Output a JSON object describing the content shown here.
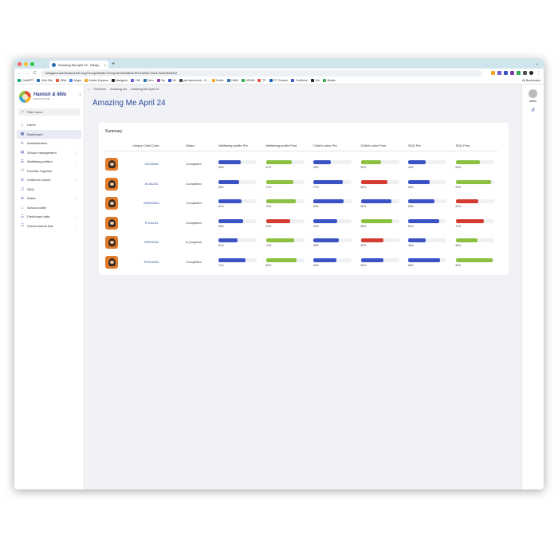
{
  "browser": {
    "tab_title": "Amazing Me April 24 - Navig...",
    "tab_close": "×",
    "new_tab": "+",
    "url": "navigator.hamishandmilo.org/GroupDetails?GroupId=09c0f62b-8f13-6850-34c3-3a1038334af",
    "back": "←",
    "forward": "→",
    "reload": "C",
    "bookmarks": [
      "ChatGPT",
      "Visit Site",
      "OBie",
      "Maps",
      "Adobe Express",
      "Navigator",
      "HM",
      "Xero",
      "Sq",
      "YA",
      "ppt framework - G...",
      "Buffer",
      "HMM",
      "AR365",
      "TP",
      "RT Cleaner",
      "OneDrive",
      "Goi",
      "Bmato"
    ],
    "all_bookmarks": "All Bookmarks"
  },
  "sidebar": {
    "logo_title": "Hamish & Milo",
    "logo_sub": "NAVIGATOR",
    "filter_label": "Filter menu",
    "items": [
      {
        "label": "Home",
        "icon": "⌂",
        "caret": ""
      },
      {
        "label": "Dashboard",
        "icon": "▦",
        "caret": ""
      },
      {
        "label": "Administration",
        "icon": "✎",
        "caret": "⌄"
      },
      {
        "label": "School management",
        "icon": "▤",
        "caret": "⌄"
      },
      {
        "label": "Wellbeing profiles",
        "icon": "☰",
        "caret": "⌄"
      },
      {
        "label": "Families Together",
        "icon": "⚇",
        "caret": ""
      },
      {
        "label": "Childrens voices",
        "icon": "✆",
        "caret": "⌄"
      },
      {
        "label": "SDQ",
        "icon": "▢",
        "caret": ""
      },
      {
        "label": "Notes",
        "icon": "✉",
        "caret": "⌄"
      },
      {
        "label": "School profile",
        "icon": "⌂",
        "caret": ""
      },
      {
        "label": "Dashboard data",
        "icon": "☷",
        "caret": "⌄"
      },
      {
        "label": "Global shared lists",
        "icon": "☷",
        "caret": "⌄"
      }
    ]
  },
  "breadcrumb": {
    "home": "⌂",
    "items": [
      "Overview",
      "Amazing me",
      "Amazing Me April 24"
    ]
  },
  "page_title": "Amazing Me April 24",
  "summary": {
    "title": "Summary",
    "columns": [
      "Unique Child Code",
      "Status",
      "Wellbeing profile Pre",
      "Wellbeing profile Post",
      "Child's voice Pre",
      "Child's voice Post",
      "SDQ Pre",
      "SDQ Post"
    ],
    "rows": [
      {
        "code": "OC04246",
        "status": "Completed",
        "scores": [
          {
            "label": "58%",
            "value": 0.58,
            "color": "#3a52c4"
          },
          {
            "label": "67%",
            "value": 0.67,
            "color": "#8cc040"
          },
          {
            "label": "46%",
            "value": 0.46,
            "color": "#3a52c4"
          },
          {
            "label": "54%",
            "value": 0.54,
            "color": "#8cc040"
          },
          {
            "label": "46%",
            "value": 0.46,
            "color": "#3a52c4"
          },
          {
            "label": "63%",
            "value": 0.63,
            "color": "#8cc040"
          }
        ]
      },
      {
        "code": "EL04243",
        "status": "Completed",
        "scores": [
          {
            "label": "55%",
            "value": 0.55,
            "color": "#3a52c4"
          },
          {
            "label": "72%",
            "value": 0.72,
            "color": "#8cc040"
          },
          {
            "label": "77%",
            "value": 0.77,
            "color": "#3a52c4"
          },
          {
            "label": "69%",
            "value": 0.69,
            "color": "#d43c32"
          },
          {
            "label": "56%",
            "value": 0.56,
            "color": "#3a52c4"
          },
          {
            "label": "92%",
            "value": 0.92,
            "color": "#8cc040"
          }
        ]
      },
      {
        "code": "EM004243",
        "status": "Completed",
        "scores": [
          {
            "label": "61%",
            "value": 0.61,
            "color": "#3a52c4"
          },
          {
            "label": "79%",
            "value": 0.79,
            "color": "#8cc040"
          },
          {
            "label": "80%",
            "value": 0.8,
            "color": "#3a52c4"
          },
          {
            "label": "80%",
            "value": 0.8,
            "color": "#3a52c4"
          },
          {
            "label": "68%",
            "value": 0.68,
            "color": "#3a52c4"
          },
          {
            "label": "60%",
            "value": 0.6,
            "color": "#d43c32"
          }
        ]
      },
      {
        "code": "FC04244",
        "status": "Completed",
        "scores": [
          {
            "label": "65%",
            "value": 0.65,
            "color": "#3a52c4"
          },
          {
            "label": "64%",
            "value": 0.64,
            "color": "#d43c32"
          },
          {
            "label": "63%",
            "value": 0.63,
            "color": "#3a52c4"
          },
          {
            "label": "83%",
            "value": 0.83,
            "color": "#8cc040"
          },
          {
            "label": "81%",
            "value": 0.81,
            "color": "#3a52c4"
          },
          {
            "label": "74%",
            "value": 0.74,
            "color": "#d43c32"
          }
        ]
      },
      {
        "code": "MH04248",
        "status": "In progress",
        "scores": [
          {
            "label": "51%",
            "value": 0.51,
            "color": "#3a52c4"
          },
          {
            "label": "74%",
            "value": 0.74,
            "color": "#8cc040"
          },
          {
            "label": "66%",
            "value": 0.66,
            "color": "#3a52c4"
          },
          {
            "label": "60%",
            "value": 0.6,
            "color": "#d43c32"
          },
          {
            "label": "46%",
            "value": 0.46,
            "color": "#3a52c4"
          },
          {
            "label": "58%",
            "value": 0.58,
            "color": "#8cc040"
          }
        ]
      },
      {
        "code": "PLE04243",
        "status": "Completed",
        "scores": [
          {
            "label": "71%",
            "value": 0.71,
            "color": "#3a52c4"
          },
          {
            "label": "80%",
            "value": 0.8,
            "color": "#8cc040"
          },
          {
            "label": "60%",
            "value": 0.6,
            "color": "#3a52c4"
          },
          {
            "label": "60%",
            "value": 0.6,
            "color": "#3a52c4"
          },
          {
            "label": "84%",
            "value": 0.84,
            "color": "#3a52c4"
          },
          {
            "label": "96%",
            "value": 0.96,
            "color": "#8cc040"
          }
        ]
      }
    ]
  },
  "rail": {
    "user_label": "admin",
    "undo_icon": "↺"
  }
}
